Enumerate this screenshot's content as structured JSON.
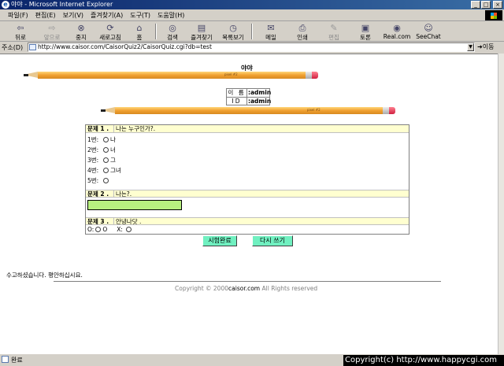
{
  "window": {
    "title": "야야 - Microsoft Internet Explorer",
    "buttons": [
      "_",
      "□",
      "×"
    ]
  },
  "menu": [
    "파일(F)",
    "편집(E)",
    "보기(V)",
    "즐겨찾기(A)",
    "도구(T)",
    "도움말(H)"
  ],
  "toolbar": {
    "back": "뒤로",
    "forward": "앞으로",
    "stop": "중지",
    "refresh": "새로고침",
    "home": "홈",
    "search": "검색",
    "favorites": "즐겨찾기",
    "history": "목록보기",
    "mail": "메일",
    "print": "인쇄",
    "edit": "편집",
    "discuss": "토론",
    "realcom": "Real.com",
    "seechat": "SeeChat"
  },
  "address": {
    "label": "주소(D)",
    "url": "http://www.caisor.com/CaisorQuiz2/CaisorQuiz.cgi?db=test",
    "go": "이동"
  },
  "page": {
    "title": "야야",
    "pencil_brand": "pixel #2",
    "user": {
      "name_label": "이 름",
      "name_value": ":admin",
      "id_label": "ID",
      "id_value": ":admin"
    },
    "questions": [
      {
        "num": "문제 1 .",
        "text": "나는 누구인가?.",
        "options": [
          {
            "label": "1번:",
            "value": "나"
          },
          {
            "label": "2번:",
            "value": "너"
          },
          {
            "label": "3번:",
            "value": "그"
          },
          {
            "label": "4번:",
            "value": "그녀"
          },
          {
            "label": "5번:",
            "value": ""
          }
        ]
      },
      {
        "num": "문제 2 .",
        "text": "나는?.",
        "answer": ""
      },
      {
        "num": "문제 3 .",
        "text": "안녕나닷 .",
        "o_label": "O:",
        "o_value": "O",
        "x_label": "X:"
      }
    ],
    "submit_label": "시험완료",
    "rewrite_label": "다시 쓰기",
    "farewell": "수고하셨습니다. 평안하십시요.",
    "copyright_prefix": "Copyright © 2000",
    "copyright_site": "caisor.com",
    "copyright_suffix": " All Rights reserved"
  },
  "status": {
    "text": "완료",
    "watermark": "Copyright(c) http://www.happycgi.com"
  }
}
